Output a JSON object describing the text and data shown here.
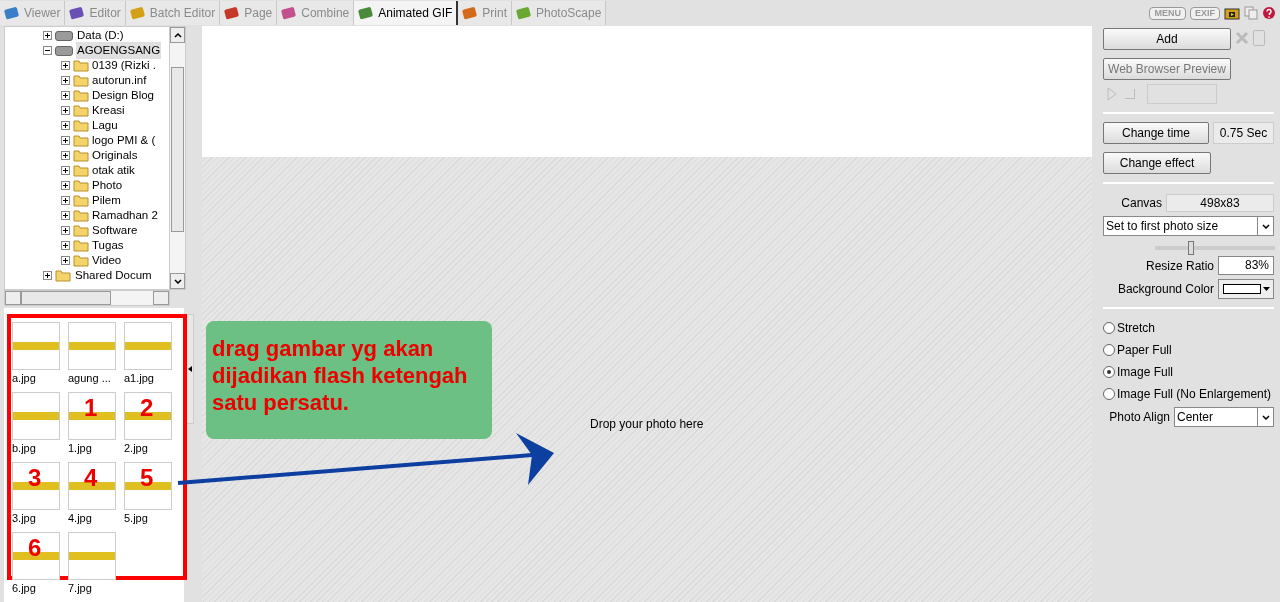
{
  "tabs": [
    {
      "label": "Viewer",
      "selected": false
    },
    {
      "label": "Editor",
      "selected": false
    },
    {
      "label": "Batch Editor",
      "selected": false
    },
    {
      "label": "Page",
      "selected": false
    },
    {
      "label": "Combine",
      "selected": false
    },
    {
      "label": "Animated GIF",
      "selected": true
    },
    {
      "label": "Print",
      "selected": false
    },
    {
      "label": "PhotoScape",
      "selected": false
    }
  ],
  "toolbar": {
    "menu_button": "MENU",
    "exif_button": "EXIF"
  },
  "tree": [
    {
      "label": "Data (D:)",
      "expanded": false,
      "selected": false,
      "kind": "drive"
    },
    {
      "label": "AGOENGSANG",
      "expanded": true,
      "selected": true,
      "kind": "drive",
      "children": [
        {
          "label": "0139 (Rizki ."
        },
        {
          "label": "autorun.inf"
        },
        {
          "label": "Design Blog"
        },
        {
          "label": "Kreasi"
        },
        {
          "label": "Lagu"
        },
        {
          "label": "logo PMI & ("
        },
        {
          "label": "Originals"
        },
        {
          "label": "otak atik"
        },
        {
          "label": "Photo"
        },
        {
          "label": "Pilem"
        },
        {
          "label": "Ramadhan 2"
        },
        {
          "label": "Software"
        },
        {
          "label": "Tugas"
        },
        {
          "label": "Video"
        }
      ]
    },
    {
      "label": "Shared Docum",
      "expanded": false,
      "selected": false,
      "kind": "folder"
    }
  ],
  "thumbnails": [
    {
      "name": "a.jpg"
    },
    {
      "name": "agung ..."
    },
    {
      "name": "a1.jpg"
    },
    {
      "name": "b.jpg"
    },
    {
      "name": "1.jpg",
      "mark": "1"
    },
    {
      "name": "2.jpg",
      "mark": "2"
    },
    {
      "name": "3.jpg",
      "mark": "3"
    },
    {
      "name": "4.jpg",
      "mark": "4"
    },
    {
      "name": "5.jpg",
      "mark": "5"
    },
    {
      "name": "6.jpg",
      "mark": "6"
    },
    {
      "name": "7.jpg"
    }
  ],
  "canvas_area": {
    "drop_hint": "Drop your photo here"
  },
  "annotation": {
    "note": "drag gambar yg akan dijadikan flash ketengah satu persatu."
  },
  "side_panel": {
    "add_button": "Add",
    "preview_button": "Web Browser Preview",
    "change_time_button": "Change time",
    "time_value": "0.75 Sec",
    "change_effect_button": "Change effect",
    "canvas_label": "Canvas",
    "canvas_value": "498x83",
    "size_mode": "Set to first photo size",
    "resize_slider": {
      "level": 0.3
    },
    "resize_ratio_label": "Resize Ratio",
    "resize_ratio": "83%",
    "background_color_label": "Background Color",
    "fit_options": [
      {
        "label": "Stretch",
        "selected": false
      },
      {
        "label": "Paper Full",
        "selected": false
      },
      {
        "label": "Image Full",
        "selected": true
      },
      {
        "label": "Image Full (No Enlargement)",
        "selected": false
      }
    ],
    "photo_align_label": "Photo Align",
    "photo_align": "Center"
  }
}
